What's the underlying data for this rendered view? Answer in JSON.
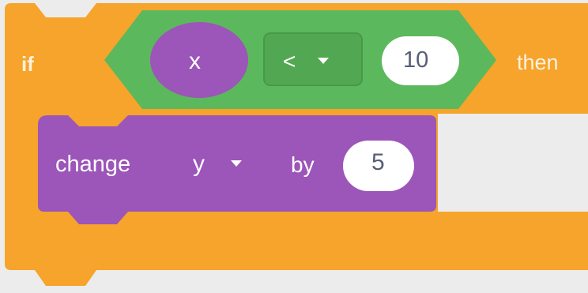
{
  "if_block": {
    "if_label": "if",
    "then_label": "then",
    "color": "#f5a623"
  },
  "condition": {
    "variable": "x",
    "operator": "<",
    "value": "10",
    "color": "#5cb85c",
    "operator_icon": "chevron-down-icon"
  },
  "change_block": {
    "label": "change",
    "variable": "y",
    "by_label": "by",
    "value": "5",
    "color": "#9b59b6",
    "variable_icon": "chevron-down-icon"
  }
}
